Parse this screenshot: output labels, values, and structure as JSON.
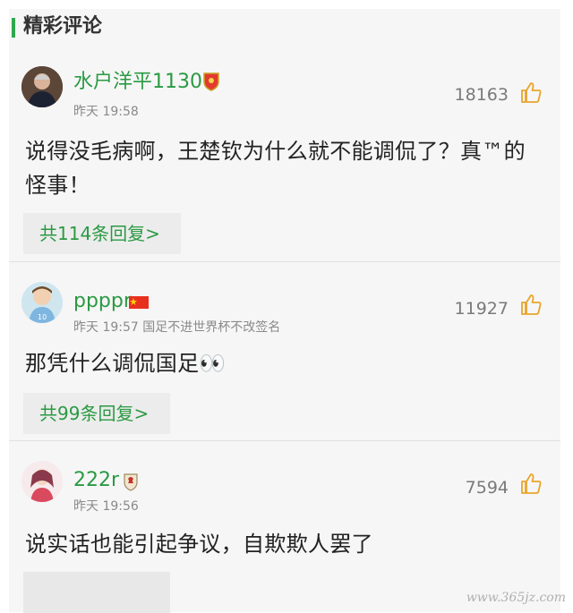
{
  "section": {
    "title": "精彩评论"
  },
  "comments": [
    {
      "username": "水户洋平1130",
      "meta": "昨天 19:58",
      "likes": "18163",
      "text_line1": "说得没毛病啊，王楚钦为什么就不能调侃了？真™的",
      "text_line2": "怪事！",
      "reply_label": "共114条回复>",
      "badge_icon": "shield-badge-icon"
    },
    {
      "username": "ppppr",
      "meta": "昨天 19:57 国足不进世界杯不改签名",
      "likes": "11927",
      "text_line1": "那凭什么调侃国足",
      "emoji": "👀",
      "reply_label": "共99条回复>",
      "badge_icon": "flag-badge-icon"
    },
    {
      "username": "222r",
      "meta": "昨天 19:56",
      "likes": "7594",
      "text_line1": "说实话也能引起争议，自欺欺人罢了",
      "badge_icon": "crest-badge-icon"
    }
  ],
  "watermark": "www.365jz.com",
  "colors": {
    "accent": "#2a9a43",
    "background": "#f6f6f6"
  }
}
